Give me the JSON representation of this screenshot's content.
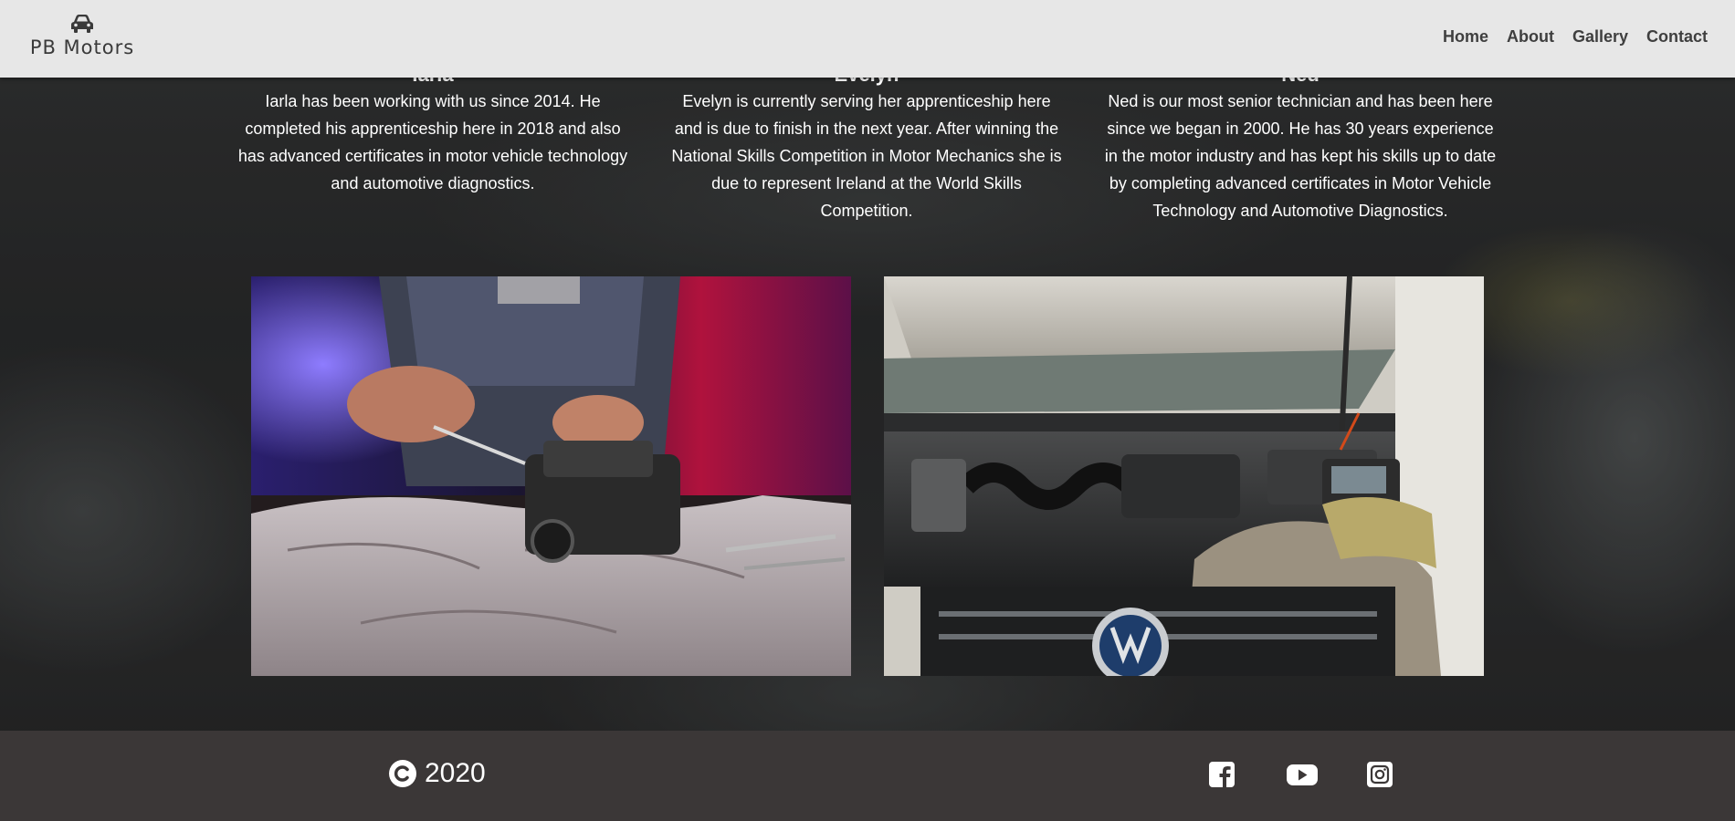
{
  "brand": {
    "name": "PB Motors",
    "icon": "car-icon"
  },
  "nav": {
    "links": [
      {
        "label": "Home"
      },
      {
        "label": "About"
      },
      {
        "label": "Gallery"
      },
      {
        "label": "Contact"
      }
    ]
  },
  "team": [
    {
      "name": "Iarla",
      "bio": "Iarla has been working with us since 2014. He completed his apprenticeship here in 2018 and also has advanced certificates in motor vehicle technology and automotive diagnostics."
    },
    {
      "name": "Evelyn",
      "bio": "Evelyn is currently serving her apprenticeship here and is due to finish in the next year. After winning the National Skills Competition in Motor Mechanics she is due to represent Ireland at the World Skills Competition."
    },
    {
      "name": "Ned",
      "bio": "Ned is our most senior technician and has been here since we began in 2000. He has 30 years experience in the motor industry and has kept his skills up to date by completing advanced certificates in Motor Vehicle Technology and Automotive Diagnostics."
    }
  ],
  "gallery": {
    "images": [
      {
        "subject": "mechanic-working-on-carburetor"
      },
      {
        "subject": "volkswagen-engine-bay-with-diagnostic-tool"
      }
    ]
  },
  "footer": {
    "copyright_icon": "copyright-icon",
    "year": "2020",
    "social": [
      {
        "icon": "facebook-icon"
      },
      {
        "icon": "youtube-icon"
      },
      {
        "icon": "instagram-icon"
      }
    ]
  },
  "colors": {
    "navbar_bg": "#e7e7e7",
    "nav_text": "#3f3f3f",
    "footer_bg": "#3b3737",
    "text": "#ffffff"
  }
}
